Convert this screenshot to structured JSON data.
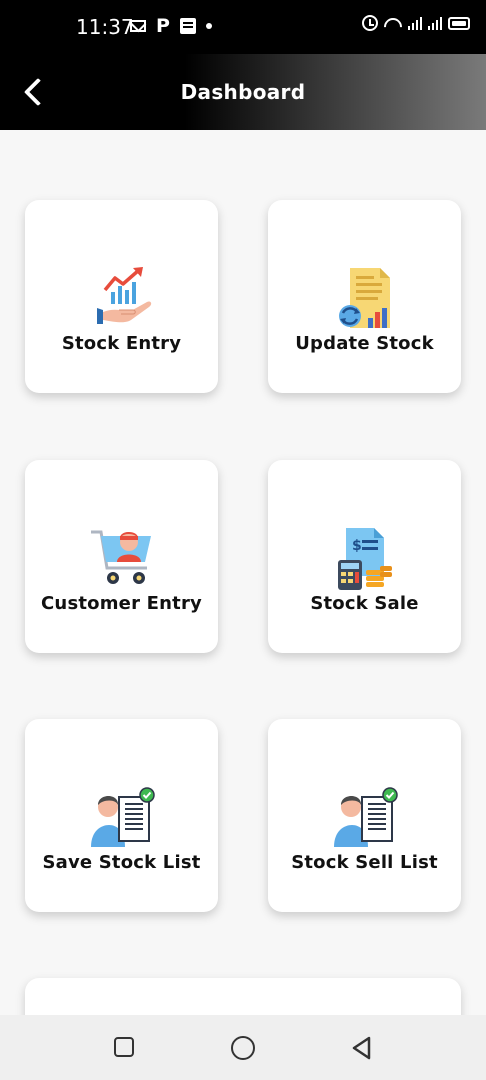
{
  "status_bar": {
    "time": "11:37",
    "left_icons": [
      "mail-icon",
      "parking-icon",
      "note-icon",
      "dot-icon"
    ],
    "right_icons": [
      "alarm-icon",
      "wifi-icon",
      "signal-icon",
      "signal-icon",
      "battery-icon"
    ]
  },
  "app_bar": {
    "title": "Dashboard",
    "back_icon": "back-arrow-icon"
  },
  "tiles": [
    {
      "label": "Stock Entry",
      "icon": "stock-entry-icon"
    },
    {
      "label": "Update Stock",
      "icon": "update-stock-icon"
    },
    {
      "label": "Customer Entry",
      "icon": "customer-entry-icon"
    },
    {
      "label": "Stock Sale",
      "icon": "stock-sale-icon"
    },
    {
      "label": "Save Stock List",
      "icon": "save-stock-list-icon"
    },
    {
      "label": "Stock Sell List",
      "icon": "stock-sell-list-icon"
    }
  ],
  "nav_bar": {
    "icons": [
      "recent-apps-icon",
      "home-icon",
      "back-icon"
    ]
  },
  "colors": {
    "app_bar_start": "#000000",
    "app_bar_end": "#7a7a7a",
    "background": "#f7f7f7",
    "card": "#ffffff"
  }
}
